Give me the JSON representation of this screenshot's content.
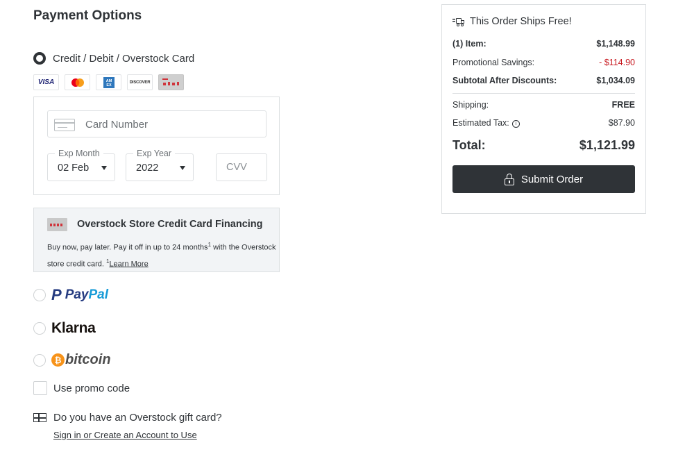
{
  "page": {
    "title": "Payment Options"
  },
  "payment_methods": {
    "card": {
      "label": "Credit / Debit / Overstock Card",
      "selected": true,
      "accepted_cards": [
        {
          "name": "Visa",
          "text": "VISA"
        },
        {
          "name": "Mastercard",
          "text": ""
        },
        {
          "name": "American Express",
          "text": "AM EX"
        },
        {
          "name": "Discover",
          "text": "DISCOVER"
        },
        {
          "name": "Overstock Store Card",
          "text": ""
        }
      ],
      "card_number_placeholder": "Card Number",
      "exp_month_label": "Exp Month",
      "exp_month_value": "02 Feb",
      "exp_year_label": "Exp Year",
      "exp_year_value": "2022",
      "cvv_placeholder": "CVV"
    },
    "financing": {
      "title": "Overstock Store Credit Card Financing",
      "text_part1": "Buy now, pay later. Pay it off in up to 24 months",
      "sup1": "1",
      "text_part2": " with the Overstock store credit card. ",
      "sup2": "1",
      "link": "Learn More"
    },
    "paypal": {
      "pay": "Pay",
      "pal": "Pal",
      "icon": "P",
      "selected": false
    },
    "klarna": {
      "label": "Klarna",
      "selected": false
    },
    "bitcoin": {
      "label": "bitcoin",
      "icon": "₿",
      "selected": false
    }
  },
  "promo": {
    "label": "Use promo code",
    "checked": false
  },
  "gift_card": {
    "question": "Do you have an Overstock gift card?",
    "link": "Sign in or Create an Account to Use"
  },
  "summary": {
    "ships_free": "This Order Ships Free!",
    "item_label": "(1) Item:",
    "item_value": "$1,148.99",
    "savings_label": "Promotional Savings:",
    "savings_value": "- $114.90",
    "subtotal_label": "Subtotal After Discounts:",
    "subtotal_value": "$1,034.09",
    "shipping_label": "Shipping:",
    "shipping_value": "FREE",
    "tax_label": "Estimated Tax:",
    "tax_value": "$87.90",
    "total_label": "Total:",
    "total_value": "$1,121.99",
    "submit_label": "Submit Order",
    "colors": {
      "savings": "#c7171e",
      "button": "#2f3337"
    }
  }
}
